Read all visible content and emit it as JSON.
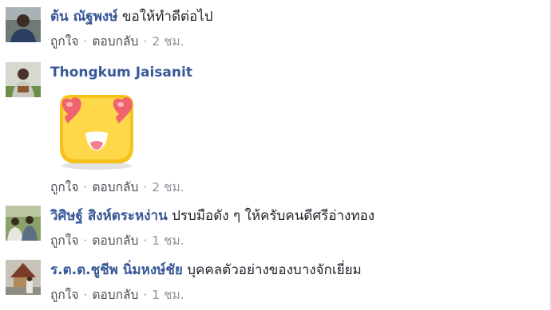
{
  "comments": [
    {
      "author": "ต้น ณัฐพงษ์",
      "text": "ขอให้ทำดีต่อไป",
      "like_label": "ถูกใจ",
      "reply_label": "ตอบกลับ",
      "time": "2 ชม.",
      "avatar_icon": "person-avatar"
    },
    {
      "author": "Thongkum Jaisanit",
      "text": "",
      "sticker_icon": "heart-eyes-emoji-sticker",
      "like_label": "ถูกใจ",
      "reply_label": "ตอบกลับ",
      "time": "2 ชม.",
      "avatar_icon": "person-avatar"
    },
    {
      "author": "วิศิษฐ์ สิงห์ตระหง่าน",
      "text": "ปรบมือดัง ๆ ให้ครับคนดีศรีอ่างทอง",
      "like_label": "ถูกใจ",
      "reply_label": "ตอบกลับ",
      "time": "1 ชม.",
      "avatar_icon": "group-photo-avatar"
    },
    {
      "author": "ร.ต.ต.ชูชีพ นิ่มหงษ์ชัย",
      "text": "บุคคลตัวอย่างของบางจักเยี่ยม",
      "like_label": "ถูกใจ",
      "reply_label": "ตอบกลับ",
      "time": "1 ชม.",
      "avatar_icon": "temple-photo-avatar"
    }
  ],
  "colors": {
    "author": "#385898",
    "action": "#4b4f56",
    "meta": "#90949c",
    "text": "#1d2129"
  }
}
